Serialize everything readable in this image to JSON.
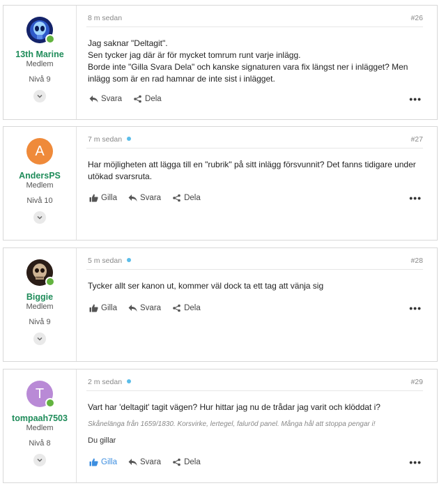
{
  "labels": {
    "reply": "Svara",
    "share": "Dela",
    "like": "Gilla",
    "more": "•••"
  },
  "posts": [
    {
      "user": "13th Marine",
      "role": "Medlem",
      "level": "Nivå 9",
      "time": "8 m sedan",
      "number": "#26",
      "new": false,
      "body": [
        "Jag saknar \"Deltagit\".",
        "Sen tycker jag där är för mycket tomrum runt varje inlägg.",
        "Borde inte \"Gilla Svara Dela\" och kanske signaturen vara fix längst ner i inlägget? Men",
        "inlägg som är en rad hamnar de inte sist i inlägget."
      ],
      "avatar": {
        "type": "image",
        "icon": "alien-icon",
        "bg": "#1a2a6b"
      }
    },
    {
      "user": "AndersPS",
      "role": "Medlem",
      "level": "Nivå 10",
      "time": "7 m sedan",
      "number": "#27",
      "new": true,
      "body": [
        "Har möjligheten att lägga till en \"rubrik\" på sitt inlägg försvunnit? Det fanns tidigare under",
        "utökad svarsruta."
      ],
      "avatar": {
        "type": "letter",
        "letter": "A",
        "bg": "#ef8a3a"
      }
    },
    {
      "user": "Biggie",
      "role": "Medlem",
      "level": "Nivå 9",
      "time": "5 m sedan",
      "number": "#28",
      "new": true,
      "body": [
        "Tycker allt ser kanon ut, kommer väl dock ta ett tag att vänja sig"
      ],
      "avatar": {
        "type": "image",
        "icon": "skull-icon",
        "bg": "#3b2a22"
      }
    },
    {
      "user": "tompaah7503",
      "role": "Medlem",
      "level": "Nivå 8",
      "time": "2 m sedan",
      "number": "#29",
      "new": true,
      "body": [
        "Vart har 'deltagit' tagit vägen? Hur hittar jag nu de trådar jag varit och klöddat i?"
      ],
      "signature": "Skånelänga från 1659/1830. Korsvirke, lertegel, faluröd panel. Många hål att stoppa pengar i!",
      "you_like": "Du gillar",
      "avatar": {
        "type": "letter",
        "letter": "T",
        "bg": "#b98ad6"
      }
    }
  ]
}
